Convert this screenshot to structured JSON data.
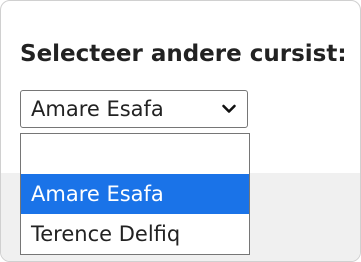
{
  "form": {
    "label": "Selecteer andere cursist:"
  },
  "select": {
    "current_value": "Amare Esafa",
    "dropdown_icon": "chevron-down-icon",
    "options": [
      {
        "label": ""
      },
      {
        "label": "Amare Esafa",
        "highlighted": true
      },
      {
        "label": "Terence Delfiq"
      }
    ]
  },
  "colors": {
    "highlight": "#1a73e8",
    "highlight_text": "#ffffff",
    "text": "#222222",
    "border": "#767676"
  }
}
